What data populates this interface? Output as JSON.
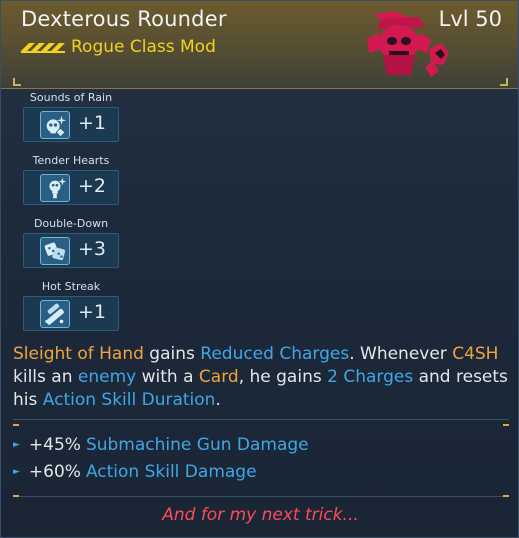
{
  "item": {
    "name": "Dexterous Rounder",
    "level": "Lvl 50",
    "type": "Rogue Class Mod",
    "rarity_color": "#f2d21a",
    "art_color": "#d21a50"
  },
  "skills": [
    {
      "name": "Sounds of Rain",
      "bonus": "+1",
      "icon": "skull-sparkle-icon"
    },
    {
      "name": "Tender Hearts",
      "bonus": "+2",
      "icon": "skull-spark-icon"
    },
    {
      "name": "Double-Down",
      "bonus": "+3",
      "icon": "dice-icon"
    },
    {
      "name": "Hot Streak",
      "bonus": "+1",
      "icon": "streak-icon"
    }
  ],
  "description": {
    "p1": "Sleight of Hand",
    "p2": " gains ",
    "p3": "Reduced Charges",
    "p4": ". Whenever ",
    "p5": "C4SH",
    "p6": " kills an ",
    "p7": "enemy",
    "p8": " with a ",
    "p9": "Card",
    "p10": ", he gains ",
    "p11": "2 Charges",
    "p12": " and resets his ",
    "p13": "Action Skill Duration",
    "p14": "."
  },
  "stats": [
    {
      "value": "+45%",
      "label": "Submachine Gun Damage"
    },
    {
      "value": "+60%",
      "label": "Action Skill Damage"
    }
  ],
  "flavor": "And for my next trick...",
  "colors": {
    "accent_orange": "#f2a43a",
    "accent_blue": "#3fa7e6",
    "flavor_red": "#ff4a57"
  }
}
